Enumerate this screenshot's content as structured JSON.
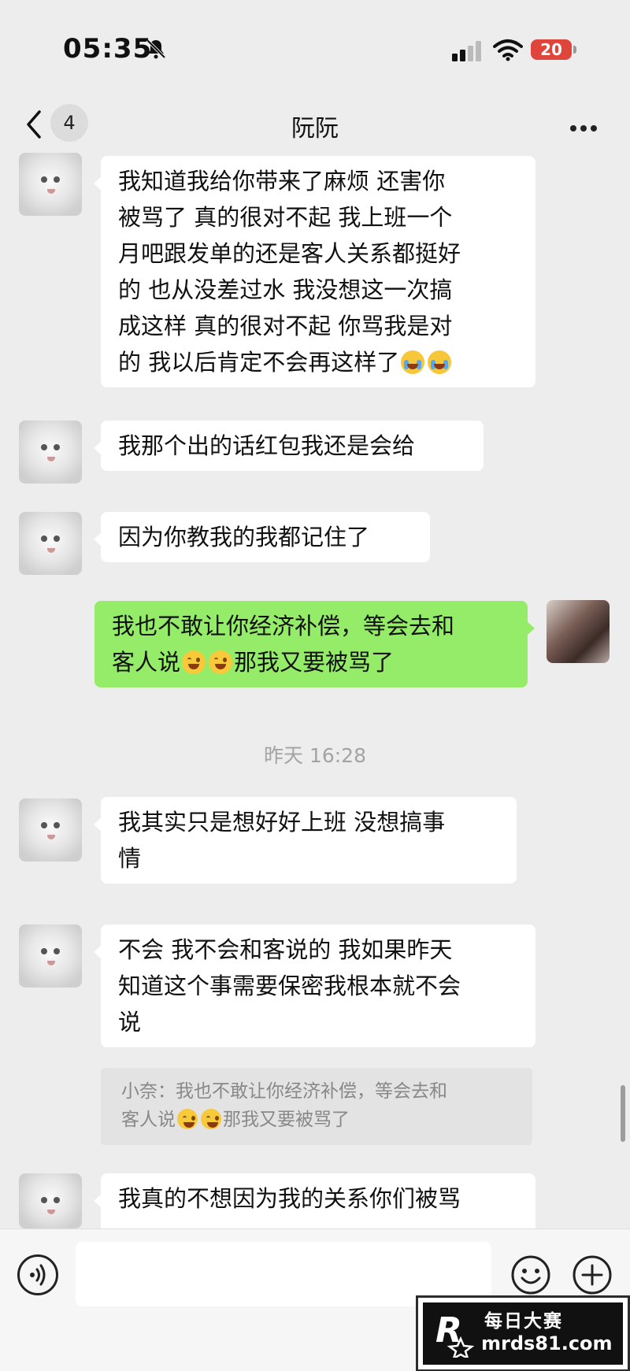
{
  "status_bar": {
    "time": "05:35",
    "battery": "20"
  },
  "nav": {
    "back_count": "4",
    "title": "阮阮"
  },
  "messages": [
    {
      "lines": [
        "我知道我给你带来了麻烦 还害你",
        "被骂了 真的很对不起 我上班一个",
        "月吧跟发单的还是客人关系都挺好",
        "的 也从没差过水 我没想这一次搞",
        "成这样 真的很对不起 你骂我是对",
        "的 我以后肯定不会再这样了"
      ]
    },
    {
      "text": "我那个出的话红包我还是会给"
    },
    {
      "text": "因为你教我的我都记住了"
    },
    {
      "lines": [
        "我也不敢让你经济补偿，等会去和",
        "客人说",
        "那我又要被骂了"
      ]
    },
    {
      "lines": [
        "我其实只是想好好上班 没想搞事",
        "情"
      ]
    },
    {
      "lines": [
        "不会 我不会和客说的 我如果昨天",
        "知道这个事需要保密我根本就不会",
        "说"
      ]
    },
    {
      "text": "我真的不想因为我的关系你们被骂"
    }
  ],
  "timestamp": "昨天 16:28",
  "quote": {
    "line1": "小奈：我也不敢让你经济补偿，等会去和",
    "line2a": "客人说",
    "line2b": "那我又要被骂了"
  },
  "icons": {
    "mute": "bell-slash-icon",
    "voice": "voice-input-icon",
    "emoji": "emoji-icon",
    "plus": "plus-icon"
  },
  "colors": {
    "outgoing_bubble": "#95ec69",
    "incoming_bubble": "#ffffff",
    "background": "#ededed"
  },
  "watermark": {
    "cn": "每日大赛",
    "url": "mrds81.com",
    "logo_letter": "R"
  }
}
